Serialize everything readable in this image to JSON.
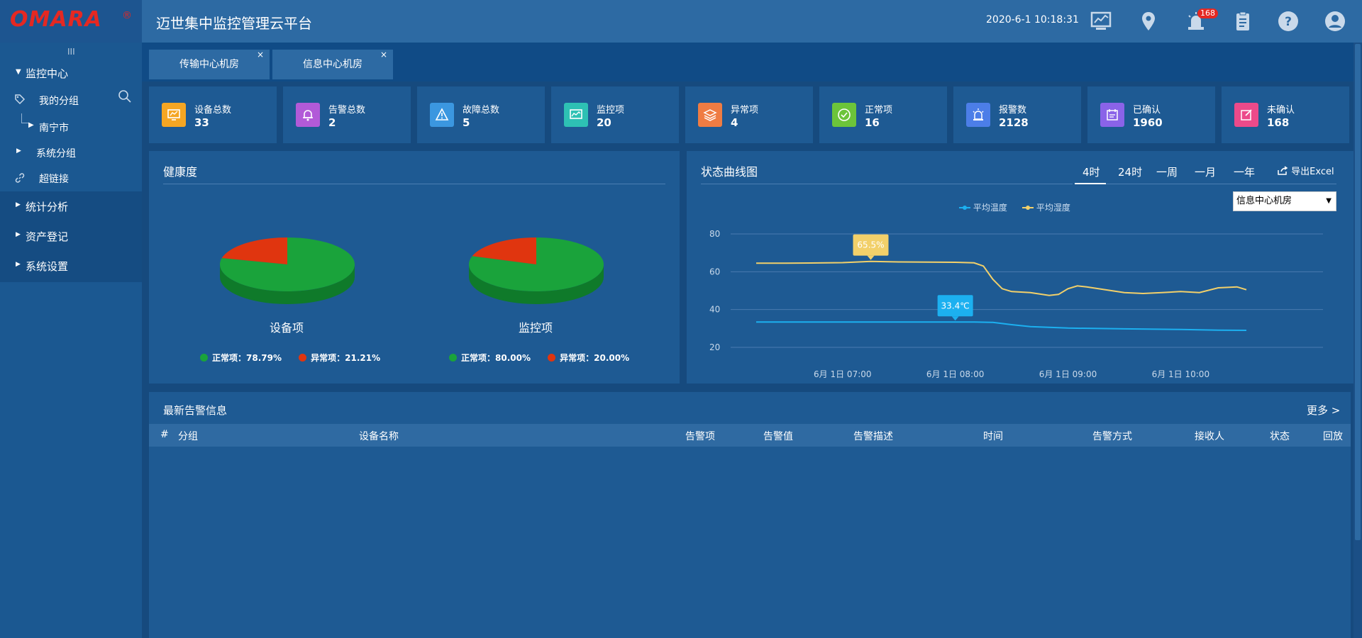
{
  "header": {
    "logo": "OMARA",
    "logo_mark": "®",
    "title": "迈世集中监控管理云平台",
    "datetime": "2020-6-1 10:18:31",
    "alarm_badge": "168"
  },
  "sidebar": {
    "grip": "III",
    "monitor_center": "监控中心",
    "my_group": "我的分组",
    "city": "南宁市",
    "system_group": "系统分组",
    "hyperlink": "超链接",
    "stats_analysis": "统计分析",
    "asset_register": "资产登记",
    "system_settings": "系统设置"
  },
  "tabs": [
    {
      "label": "传输中心机房",
      "close": "×"
    },
    {
      "label": "信息中心机房",
      "close": "×"
    }
  ],
  "stats": [
    {
      "label": "设备总数",
      "value": "33",
      "color": "#f5a623",
      "icon": "monitor-icon"
    },
    {
      "label": "告警总数",
      "value": "2",
      "color": "#b25ad8",
      "icon": "bell-icon"
    },
    {
      "label": "故障总数",
      "value": "5",
      "color": "#3b97e0",
      "icon": "warning-icon"
    },
    {
      "label": "监控项",
      "value": "20",
      "color": "#2ec1b4",
      "icon": "monitor-chart-icon"
    },
    {
      "label": "异常项",
      "value": "4",
      "color": "#ef7c43",
      "icon": "layers-icon"
    },
    {
      "label": "正常项",
      "value": "16",
      "color": "#6cc43a",
      "icon": "check-circle-icon"
    },
    {
      "label": "报警数",
      "value": "2128",
      "color": "#4c7ee8",
      "icon": "siren-icon"
    },
    {
      "label": "已确认",
      "value": "1960",
      "color": "#8a63e8",
      "icon": "calendar-check-icon"
    },
    {
      "label": "未确认",
      "value": "168",
      "color": "#ec4a8a",
      "icon": "edit-icon"
    }
  ],
  "health": {
    "title": "健康度",
    "pies": [
      {
        "name": "设备项",
        "normal_label": "正常项：78.79%",
        "abnormal_label": "异常项：21.21%",
        "normal_pct": 78.79,
        "abnormal_pct": 21.21
      },
      {
        "name": "监控项",
        "normal_label": "正常项：80.00%",
        "abnormal_label": "异常项：20.00%",
        "normal_pct": 80.0,
        "abnormal_pct": 20.0
      }
    ],
    "colors": {
      "normal": "#1aa33b",
      "abnormal": "#e0350f"
    }
  },
  "status_chart": {
    "title": "状态曲线图",
    "ranges": [
      "4时",
      "24时",
      "一周",
      "一月",
      "一年"
    ],
    "active_range": "4时",
    "export": "导出Excel",
    "room_select": "信息中心机房"
  },
  "chart_data": {
    "type": "line",
    "x_ticks": [
      "6月 1日 07:00",
      "6月 1日 08:00",
      "6月 1日 09:00",
      "6月 1日 10:00"
    ],
    "ylim": [
      20,
      80
    ],
    "y_ticks": [
      "80",
      "60",
      "40",
      "20"
    ],
    "grid": true,
    "legend_position": "top",
    "series": [
      {
        "name": "平均温度",
        "color": "#1cb0f0",
        "x": [
          "06:14",
          "06:30",
          "07:00",
          "07:30",
          "08:00",
          "08:10",
          "08:20",
          "08:30",
          "08:40",
          "09:00",
          "09:30",
          "10:00",
          "10:10",
          "10:20",
          "10:35"
        ],
        "values": [
          33.4,
          33.4,
          33.4,
          33.4,
          33.4,
          33.4,
          33.2,
          32.0,
          31.0,
          30.2,
          29.8,
          29.5,
          29.3,
          29.1,
          29.0
        ]
      },
      {
        "name": "平均湿度",
        "color": "#f2d06a",
        "x": [
          "06:14",
          "06:30",
          "07:00",
          "07:15",
          "07:30",
          "08:00",
          "08:10",
          "08:15",
          "08:20",
          "08:25",
          "08:30",
          "08:40",
          "08:45",
          "08:50",
          "08:55",
          "09:00",
          "09:05",
          "09:10",
          "09:20",
          "09:30",
          "09:40",
          "09:50",
          "10:00",
          "10:10",
          "10:20",
          "10:30",
          "10:35"
        ],
        "values": [
          64.5,
          64.5,
          64.8,
          65.5,
          65.2,
          65.0,
          64.7,
          63.0,
          56.0,
          51.0,
          49.5,
          49.0,
          48.2,
          47.5,
          48.0,
          51.0,
          52.5,
          52.0,
          50.5,
          49.0,
          48.5,
          49.0,
          49.5,
          49.0,
          51.5,
          52.0,
          50.5
        ]
      }
    ],
    "annotations": [
      {
        "series": "平均湿度",
        "x": "07:15",
        "label": "65.5%"
      },
      {
        "series": "平均温度",
        "x": "08:00",
        "label": "33.4℃"
      }
    ]
  },
  "alarms": {
    "title": "最新告警信息",
    "more": "更多 >",
    "columns": [
      "#",
      "分组",
      "设备名称",
      "告警项",
      "告警值",
      "告警描述",
      "时间",
      "告警方式",
      "接收人",
      "状态",
      "回放"
    ],
    "rows": []
  }
}
